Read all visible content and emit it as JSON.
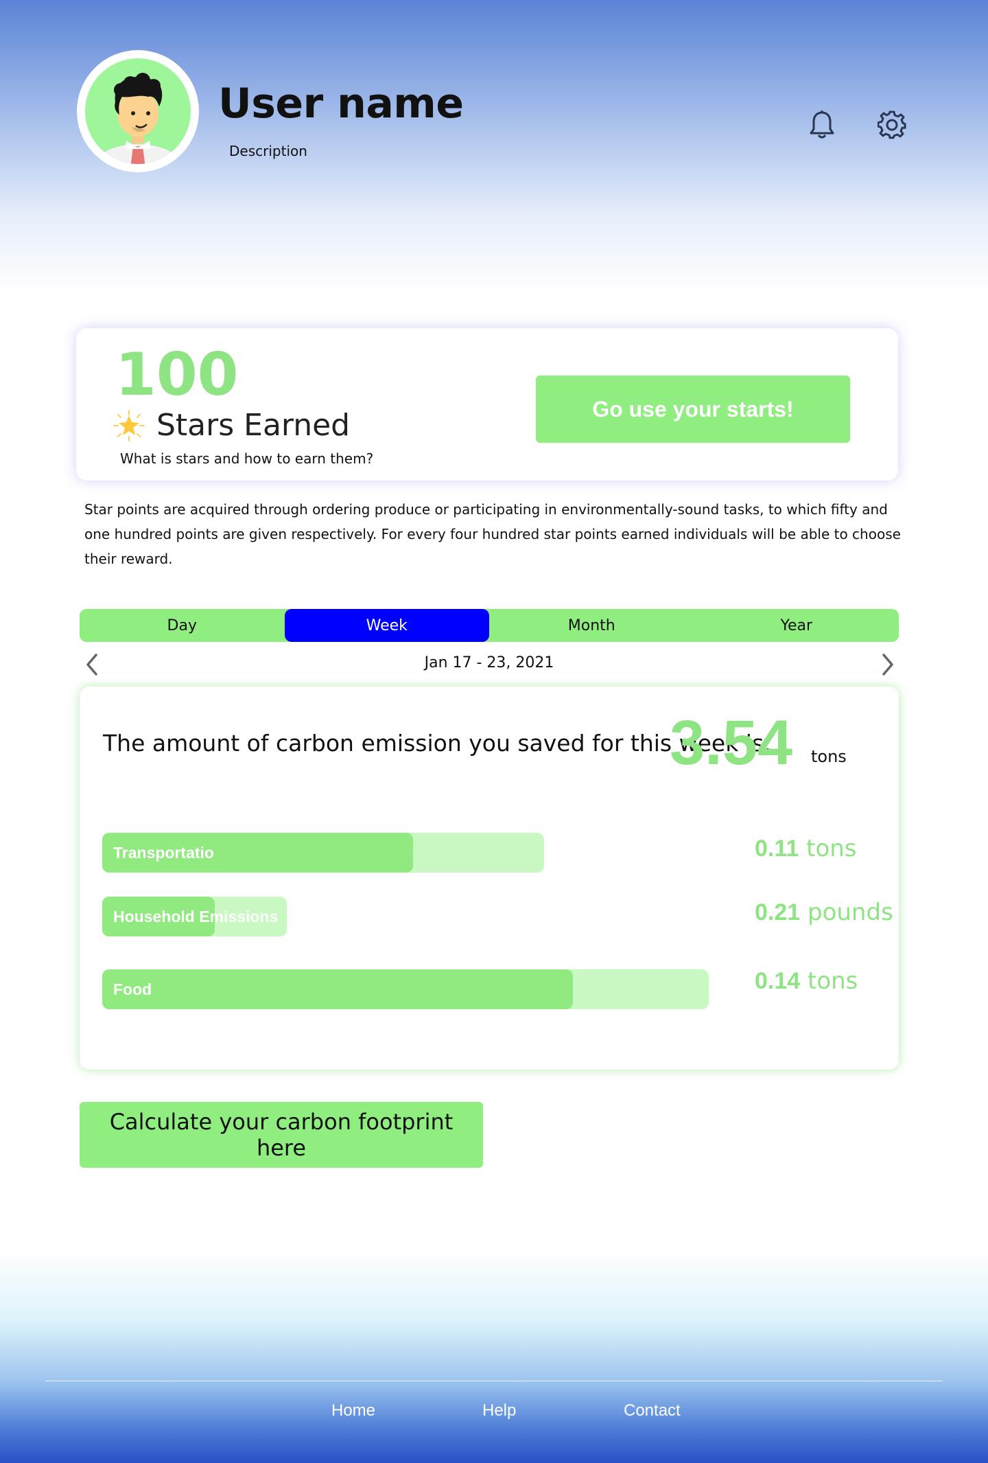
{
  "header": {
    "username": "User name",
    "description": "Description",
    "icons": [
      "avatar",
      "bell-icon",
      "gear-icon"
    ]
  },
  "stars": {
    "count": "100",
    "label": "Stars Earned",
    "help_link": "What is stars and how to earn them?",
    "button_label": "Go use your starts!",
    "explanation": "Star points are acquired through ordering produce or participating in environmentally-sound tasks, to which fifty and one hundred points are given respectively. For every four hundred star points earned individuals will be able to choose their reward."
  },
  "period_tabs": [
    {
      "label": "Day",
      "active": false
    },
    {
      "label": "Week",
      "active": true
    },
    {
      "label": "Month",
      "active": false
    },
    {
      "label": "Year",
      "active": false
    }
  ],
  "date_range": "Jan 17 - 23, 2021",
  "emissions": {
    "summary_text": "The amount of carbon emission you saved for this week is:",
    "total_value": "3.54",
    "total_unit": "tons",
    "categories": [
      {
        "label": "Transportatio",
        "value": "0.11",
        "unit": "tons",
        "fill_fraction": 0.703
      },
      {
        "label": "Household Emissions",
        "value": "0.21",
        "unit": "pounds",
        "fill_fraction": 0.608
      },
      {
        "label": "Food",
        "value": "0.14",
        "unit": "tons",
        "fill_fraction": 0.776
      }
    ]
  },
  "calculate_button": "Calculate your carbon footprint here",
  "footer": {
    "links": [
      "Home",
      "Help",
      "Contact"
    ]
  },
  "colors": {
    "accent_green": "#90ee80",
    "active_tab": "#0000ff",
    "value_green": "#8ee483"
  }
}
